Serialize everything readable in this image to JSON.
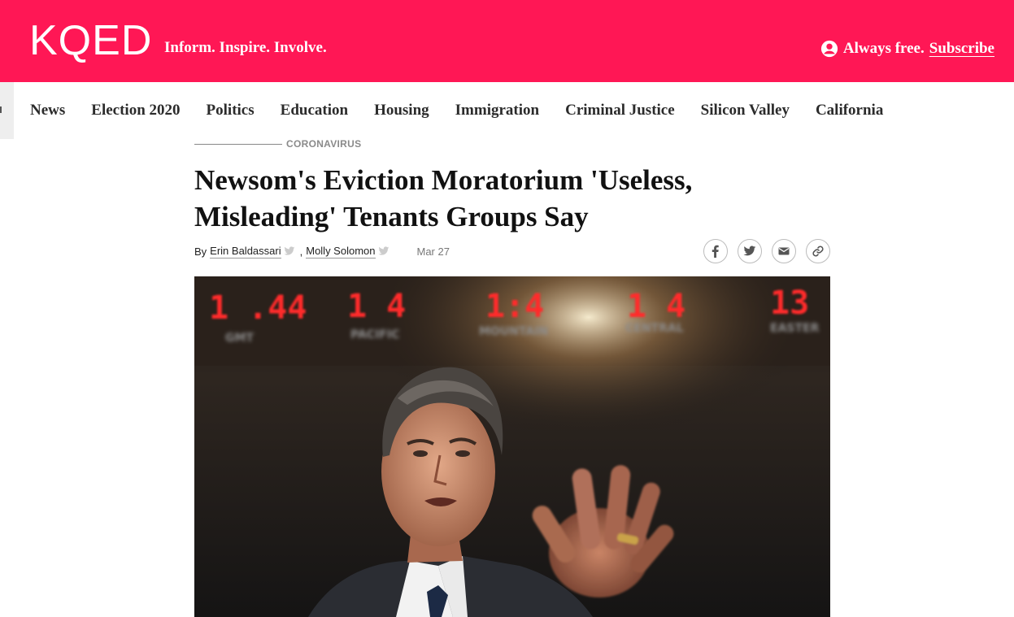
{
  "header": {
    "logo": "KQED",
    "tagline": "Inform. Inspire. Involve.",
    "account_text": "Always free.",
    "subscribe_label": "Subscribe",
    "brand_color": "#ff1755"
  },
  "nav": {
    "items": [
      {
        "label": "News"
      },
      {
        "label": "Election 2020"
      },
      {
        "label": "Politics"
      },
      {
        "label": "Education"
      },
      {
        "label": "Housing"
      },
      {
        "label": "Immigration"
      },
      {
        "label": "Criminal Justice"
      },
      {
        "label": "Silicon Valley"
      },
      {
        "label": "California"
      }
    ]
  },
  "article": {
    "category": "CORONAVIRUS",
    "headline_line1": "Newsom's Eviction Moratorium 'Useless,",
    "headline_line2": "Misleading' Tenants Groups Say",
    "byline_prefix": "By",
    "authors": [
      {
        "name": "Erin Baldassari"
      },
      {
        "name": "Molly Solomon"
      }
    ],
    "author_separator": ",",
    "date": "Mar 27",
    "share_icons": [
      "facebook-icon",
      "twitter-icon",
      "email-icon",
      "link-icon"
    ]
  },
  "hero": {
    "clock_readouts": [
      "1 .44",
      "1  4",
      "1:4",
      "1  4",
      "13"
    ],
    "clock_labels": [
      "GMT",
      "PACIFIC",
      "MOUNTAIN",
      "CENTRAL",
      "EASTER"
    ]
  }
}
